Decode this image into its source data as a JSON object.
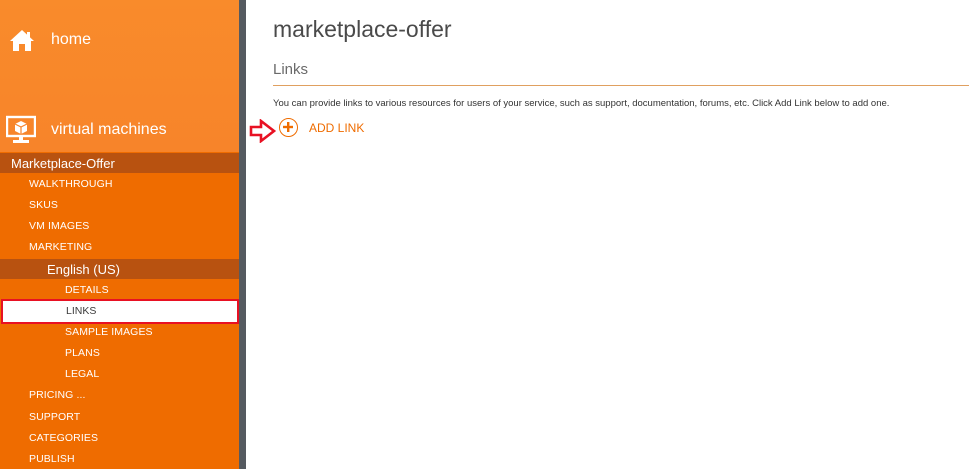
{
  "sidebar": {
    "home_label": "home",
    "vms_label": "virtual machines",
    "offer_label": "Marketplace-Offer",
    "items_top": [
      "WALKTHROUGH",
      "SKUS",
      "VM IMAGES",
      "MARKETING"
    ],
    "language_label": "English (US)",
    "lang_items": {
      "details": "DETAILS",
      "links": "LINKS",
      "sample_images": "SAMPLE IMAGES",
      "plans": "PLANS",
      "legal": "LEGAL"
    },
    "items_bottom": [
      "PRICING ...",
      "SUPPORT",
      "CATEGORIES",
      "PUBLISH"
    ]
  },
  "main": {
    "title": "marketplace-offer",
    "section_title": "Links",
    "description": "You can provide links to various resources for users of your service, such as support, documentation, forums, etc. Click Add Link below to add one.",
    "add_link_label": "ADD LINK"
  },
  "colors": {
    "accent": "#ef6c00",
    "highlight_border": "#e81123"
  }
}
